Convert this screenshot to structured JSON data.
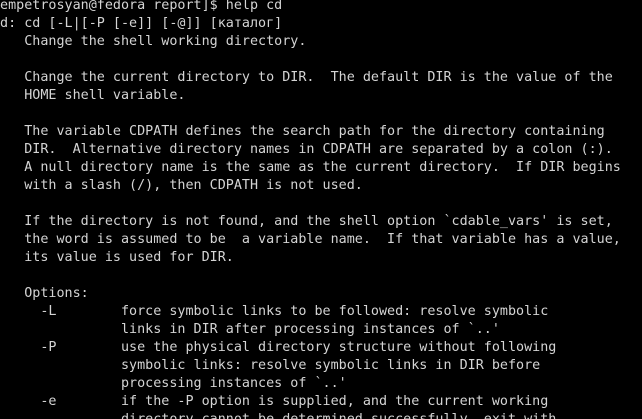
{
  "terminal": {
    "lines": [
      "[empetrosyan@fedora report]$ help cd",
      "cd: cd [-L|[-P [-e]] [-@]] [каталог]",
      "    Change the shell working directory.",
      "",
      "    Change the current directory to DIR.  The default DIR is the value of the",
      "    HOME shell variable.",
      "",
      "    The variable CDPATH defines the search path for the directory containing",
      "    DIR.  Alternative directory names in CDPATH are separated by a colon (:).",
      "    A null directory name is the same as the current directory.  If DIR begins",
      "    with a slash (/), then CDPATH is not used.",
      "",
      "    If the directory is not found, and the shell option `cdable_vars' is set,",
      "    the word is assumed to be  a variable name.  If that variable has a value,",
      "    its value is used for DIR.",
      "",
      "    Options:",
      "      -L        force symbolic links to be followed: resolve symbolic",
      "                links in DIR after processing instances of `..'",
      "      -P        use the physical directory structure without following",
      "                symbolic links: resolve symbolic links in DIR before",
      "                processing instances of `..'",
      "      -e        if the -P option is supplied, and the current working",
      "                directory cannot be determined successfully, exit with"
    ]
  },
  "colors": {
    "background": "#000000",
    "foreground": "#d4d4d4"
  }
}
